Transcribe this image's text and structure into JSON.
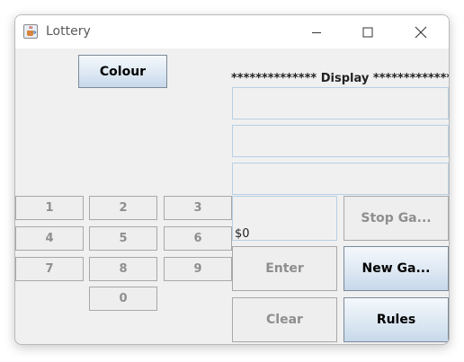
{
  "window": {
    "title": "Lottery"
  },
  "controls": {
    "minimize": "minimize",
    "maximize": "maximize",
    "close": "close"
  },
  "buttons": {
    "colour": "Colour",
    "stop_game": "Stop Ga...",
    "enter": "Enter",
    "new_game": "New Ga...",
    "clear": "Clear",
    "rules": "Rules"
  },
  "display": {
    "label": "**************  Display  ****************",
    "fields": [
      "",
      "",
      ""
    ],
    "money": "$0"
  },
  "keypad": [
    "1",
    "2",
    "3",
    "4",
    "5",
    "6",
    "7",
    "8",
    "9",
    "0"
  ],
  "icons": [
    "java-cup-icon",
    "minimize-icon",
    "maximize-icon",
    "close-icon"
  ]
}
